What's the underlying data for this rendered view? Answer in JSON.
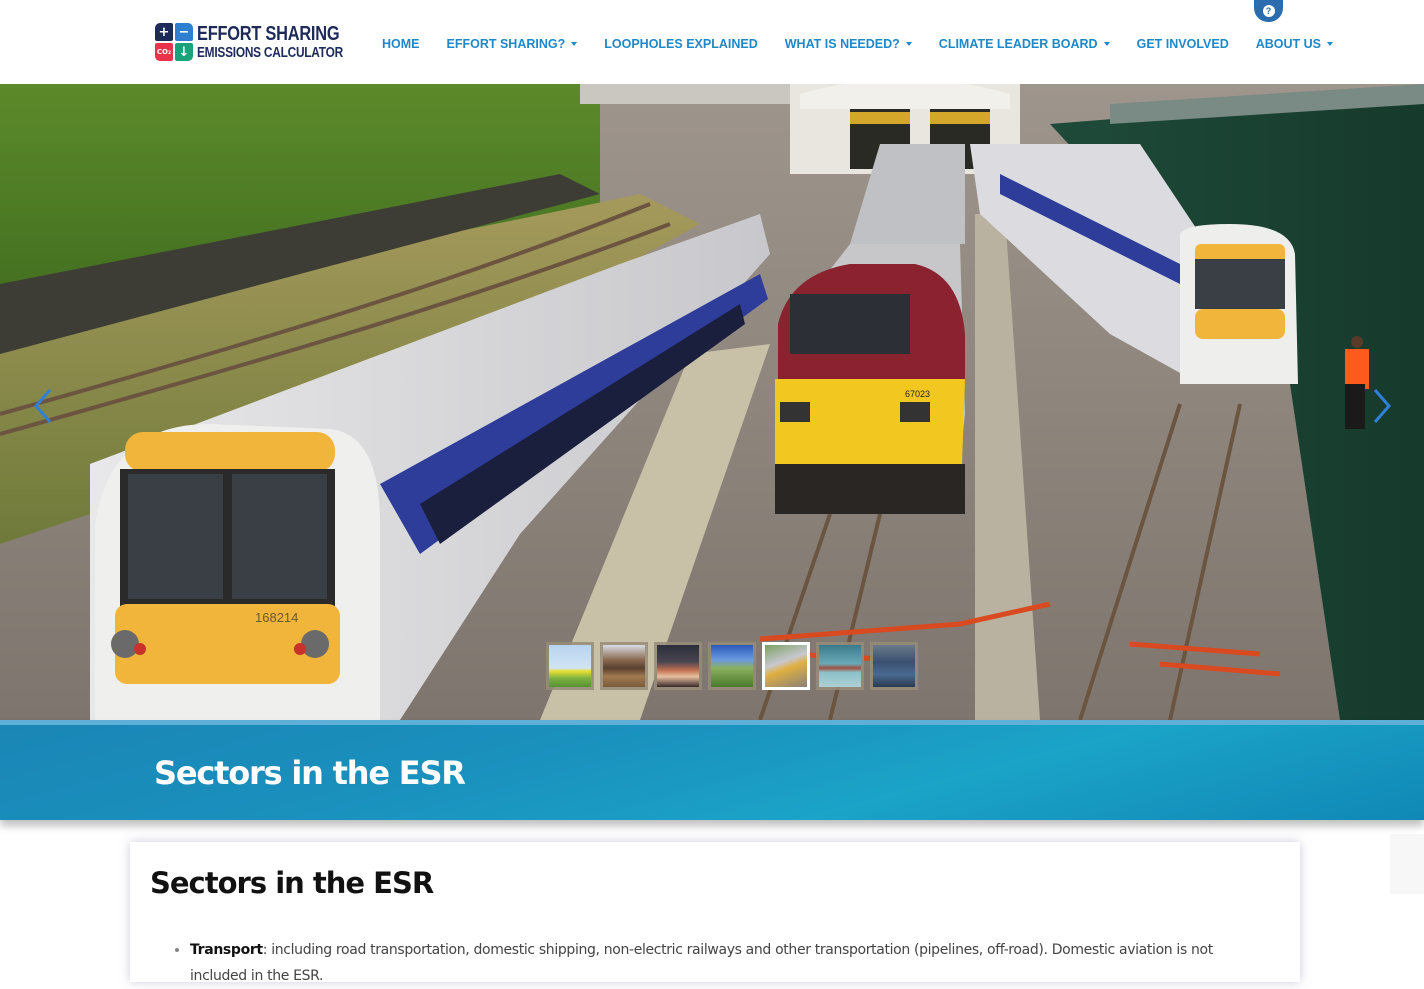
{
  "header": {
    "logo": {
      "line1": "EFFORT SHARING",
      "line2": "EMISSIONS CALCULATOR",
      "cells": [
        "+",
        "−",
        "CO₂",
        "↓"
      ]
    },
    "nav": [
      {
        "label": "HOME",
        "dropdown": false
      },
      {
        "label": "EFFORT SHARING?",
        "dropdown": true
      },
      {
        "label": "LOOPHOLES EXPLAINED",
        "dropdown": false
      },
      {
        "label": "WHAT IS NEEDED?",
        "dropdown": true
      },
      {
        "label": "CLIMATE LEADER BOARD",
        "dropdown": true
      },
      {
        "label": "GET INVOLVED",
        "dropdown": false
      },
      {
        "label": "ABOUT US",
        "dropdown": true
      }
    ],
    "help_icon": "?"
  },
  "hero": {
    "image_description": "Trains at a railway depot: white/yellow passenger trains and a red/yellow diesel locomotive",
    "train_number_left": "168214",
    "train_number_center": "67023",
    "prev_arrow": "‹",
    "next_arrow": "›",
    "thumbnails": [
      {
        "name": "tree-field",
        "active": false
      },
      {
        "name": "cattle",
        "active": false
      },
      {
        "name": "highway-night",
        "active": false
      },
      {
        "name": "grass-sky",
        "active": false
      },
      {
        "name": "trains",
        "active": true
      },
      {
        "name": "ship-water",
        "active": false
      },
      {
        "name": "building-interior",
        "active": false
      }
    ]
  },
  "band": {
    "title": "Sectors in the ESR"
  },
  "content": {
    "title": "Sectors in the ESR",
    "items": [
      {
        "bold": "Transport",
        "text": ": including road transportation, domestic shipping, non-electric railways and other transportation (pipelines, off-road). Domestic aviation is not included in the ESR."
      }
    ]
  },
  "colors": {
    "nav": "#1e88c8",
    "logo_navy": "#1d2a5a",
    "band": "#1a90bd",
    "help_tab": "#2b6cae"
  }
}
